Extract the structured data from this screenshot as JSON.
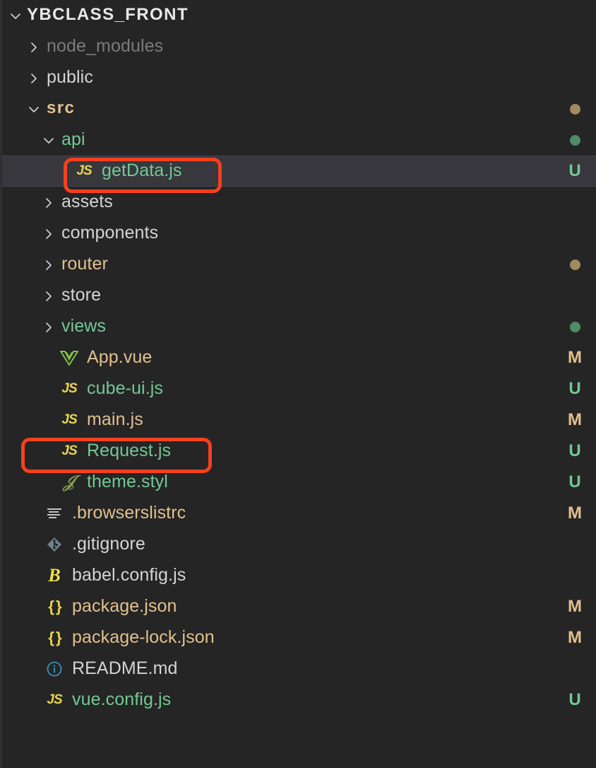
{
  "colors": {
    "background": "#252526",
    "selected_row": "#37373d",
    "text_default": "#d4d4d4",
    "text_dim": "#7b7b7b",
    "git_modified": "#e2c08d",
    "git_untracked": "#73c991",
    "annotation": "#f4411e",
    "icon_js": "#e8d44d",
    "icon_vue": "#7fc14a",
    "icon_json": "#e8d44d",
    "icon_babel": "#f0e14a",
    "icon_git": "#6d8086",
    "icon_info": "#3a8fb7",
    "icon_stylus": "#8a9a4f",
    "icon_lines": "#d4d4d4"
  },
  "explorer": {
    "root": {
      "label": "YBCLASS_FRONT",
      "twisty": "chevron-down-icon",
      "expanded": true
    },
    "rows": [
      {
        "label": "node_modules",
        "indent": 1,
        "twisty": "chevron-right-icon",
        "icon": "",
        "icon_type": "none",
        "color": "#7b7b7b",
        "status": "",
        "dot": "",
        "selected": false,
        "annotated": false
      },
      {
        "label": "public",
        "indent": 1,
        "twisty": "chevron-right-icon",
        "icon": "",
        "icon_type": "none",
        "color": "#d4d4d4",
        "status": "",
        "dot": "",
        "selected": false,
        "annotated": false
      },
      {
        "label": "src",
        "indent": 1,
        "twisty": "chevron-down-icon",
        "icon": "",
        "icon_type": "none",
        "color": "#e2c08d",
        "status": "",
        "dot": "#a08a5e",
        "selected": false,
        "annotated": false,
        "bold": true
      },
      {
        "label": "api",
        "indent": 2,
        "twisty": "chevron-down-icon",
        "icon": "",
        "icon_type": "none",
        "color": "#73c991",
        "status": "",
        "dot": "#4e8c68",
        "selected": false,
        "annotated": false
      },
      {
        "label": "getData.js",
        "indent": 3,
        "twisty": "",
        "icon": "JS",
        "icon_type": "js",
        "color": "#73c991",
        "status": "U",
        "status_color": "#73c991",
        "dot": "",
        "selected": true,
        "annotated": true
      },
      {
        "label": "assets",
        "indent": 2,
        "twisty": "chevron-right-icon",
        "icon": "",
        "icon_type": "none",
        "color": "#d4d4d4",
        "status": "",
        "dot": "",
        "selected": false,
        "annotated": false
      },
      {
        "label": "components",
        "indent": 2,
        "twisty": "chevron-right-icon",
        "icon": "",
        "icon_type": "none",
        "color": "#d4d4d4",
        "status": "",
        "dot": "",
        "selected": false,
        "annotated": false
      },
      {
        "label": "router",
        "indent": 2,
        "twisty": "chevron-right-icon",
        "icon": "",
        "icon_type": "none",
        "color": "#e2c08d",
        "status": "",
        "dot": "#a08a5e",
        "selected": false,
        "annotated": false
      },
      {
        "label": "store",
        "indent": 2,
        "twisty": "chevron-right-icon",
        "icon": "",
        "icon_type": "none",
        "color": "#d4d4d4",
        "status": "",
        "dot": "",
        "selected": false,
        "annotated": false
      },
      {
        "label": "views",
        "indent": 2,
        "twisty": "chevron-right-icon",
        "icon": "",
        "icon_type": "none",
        "color": "#73c991",
        "status": "",
        "dot": "#4e8c68",
        "selected": false,
        "annotated": false
      },
      {
        "label": "App.vue",
        "indent": 2,
        "twisty": "",
        "icon": "vue-icon",
        "icon_type": "vue",
        "color": "#e2c08d",
        "status": "M",
        "status_color": "#e2c08d",
        "dot": "",
        "selected": false,
        "annotated": false
      },
      {
        "label": "cube-ui.js",
        "indent": 2,
        "twisty": "",
        "icon": "JS",
        "icon_type": "js",
        "color": "#73c991",
        "status": "U",
        "status_color": "#73c991",
        "dot": "",
        "selected": false,
        "annotated": false
      },
      {
        "label": "main.js",
        "indent": 2,
        "twisty": "",
        "icon": "JS",
        "icon_type": "js",
        "color": "#e2c08d",
        "status": "M",
        "status_color": "#e2c08d",
        "dot": "",
        "selected": false,
        "annotated": false
      },
      {
        "label": "Request.js",
        "indent": 2,
        "twisty": "",
        "icon": "JS",
        "icon_type": "js",
        "color": "#73c991",
        "status": "U",
        "status_color": "#73c991",
        "dot": "",
        "selected": false,
        "annotated": true
      },
      {
        "label": "theme.styl",
        "indent": 2,
        "twisty": "",
        "icon": "stylus-icon",
        "icon_type": "stylus",
        "color": "#73c991",
        "status": "U",
        "status_color": "#73c991",
        "dot": "",
        "selected": false,
        "annotated": false
      },
      {
        "label": ".browserslistrc",
        "indent": 1,
        "twisty": "",
        "icon": "lines-icon",
        "icon_type": "lines",
        "color": "#e2c08d",
        "status": "M",
        "status_color": "#e2c08d",
        "dot": "",
        "selected": false,
        "annotated": false
      },
      {
        "label": ".gitignore",
        "indent": 1,
        "twisty": "",
        "icon": "git-icon",
        "icon_type": "git",
        "color": "#d4d4d4",
        "status": "",
        "dot": "",
        "selected": false,
        "annotated": false
      },
      {
        "label": "babel.config.js",
        "indent": 1,
        "twisty": "",
        "icon": "babel-icon",
        "icon_type": "babel",
        "color": "#d4d4d4",
        "status": "",
        "dot": "",
        "selected": false,
        "annotated": false
      },
      {
        "label": "package.json",
        "indent": 1,
        "twisty": "",
        "icon": "{}",
        "icon_type": "json",
        "color": "#e2c08d",
        "status": "M",
        "status_color": "#e2c08d",
        "dot": "",
        "selected": false,
        "annotated": false
      },
      {
        "label": "package-lock.json",
        "indent": 1,
        "twisty": "",
        "icon": "{}",
        "icon_type": "json",
        "color": "#e2c08d",
        "status": "M",
        "status_color": "#e2c08d",
        "dot": "",
        "selected": false,
        "annotated": false
      },
      {
        "label": "README.md",
        "indent": 1,
        "twisty": "",
        "icon": "info-icon",
        "icon_type": "info",
        "color": "#d4d4d4",
        "status": "",
        "dot": "",
        "selected": false,
        "annotated": false
      },
      {
        "label": "vue.config.js",
        "indent": 1,
        "twisty": "",
        "icon": "JS",
        "icon_type": "js",
        "color": "#73c991",
        "status": "U",
        "status_color": "#73c991",
        "dot": "",
        "selected": false,
        "annotated": false
      }
    ]
  }
}
